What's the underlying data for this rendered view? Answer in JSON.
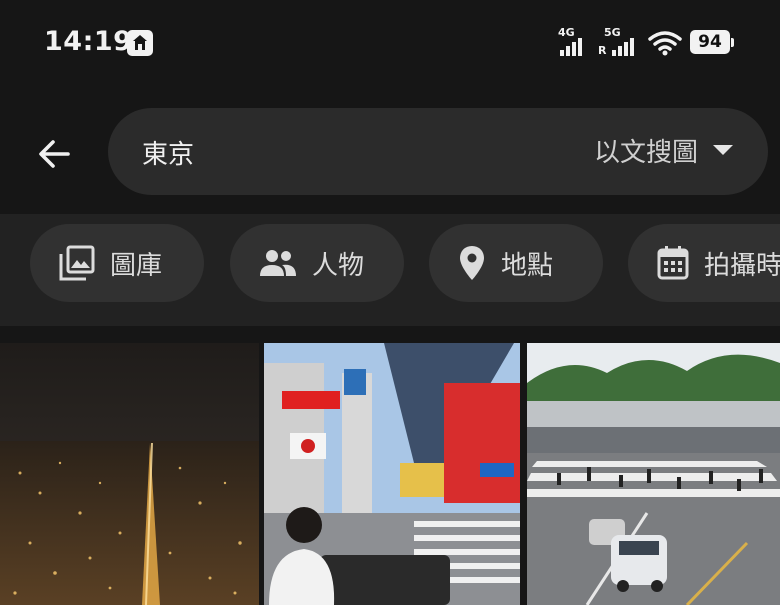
{
  "status_bar": {
    "time": "14:19",
    "network_1": "4G",
    "network_2": "5G",
    "roaming_mark": "R",
    "battery": "94"
  },
  "search": {
    "query": "東京",
    "mode": "以文搜圖"
  },
  "chips": [
    {
      "label": "圖庫",
      "icon": "photo-library-icon"
    },
    {
      "label": "人物",
      "icon": "people-icon"
    },
    {
      "label": "地點",
      "icon": "location-pin-icon"
    },
    {
      "label": "拍攝時間",
      "icon": "calendar-icon"
    }
  ],
  "photos": [
    {
      "name": "tokyo-night-cityscape"
    },
    {
      "name": "akihabara-crossing"
    },
    {
      "name": "station-crosswalk"
    }
  ],
  "colors": {
    "background": "#161616",
    "pill": "#2b2b2b",
    "chip": "#313131",
    "chip_row": "#222222"
  }
}
